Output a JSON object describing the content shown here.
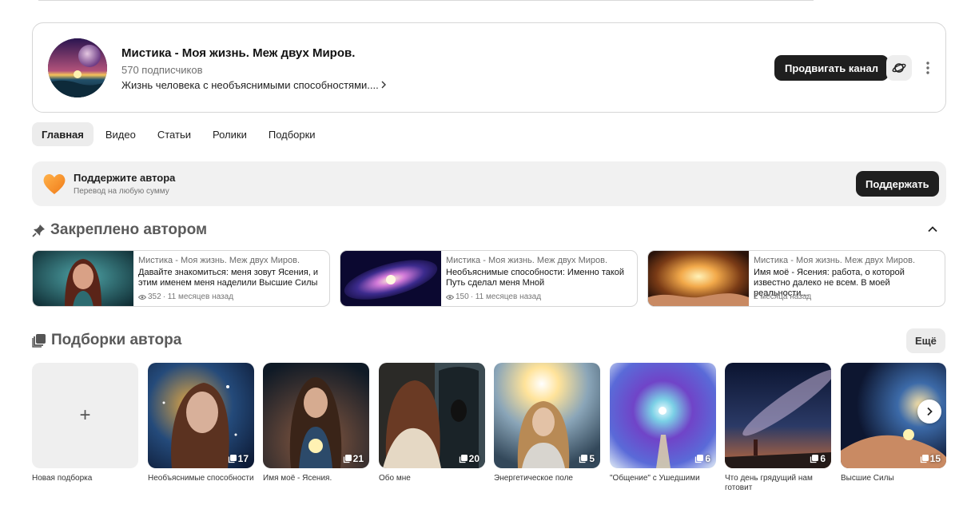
{
  "channel": {
    "title": "Мистика - Моя жизнь. Меж двух Миров.",
    "subscribers": "570 подписчиков",
    "description": "Жизнь человека с необъяснимыми способностями....",
    "promote_label": "Продвигать канал"
  },
  "tabs": [
    {
      "label": "Главная",
      "active": true
    },
    {
      "label": "Видео"
    },
    {
      "label": "Статьи"
    },
    {
      "label": "Ролики"
    },
    {
      "label": "Подборки"
    }
  ],
  "support": {
    "title": "Поддержите автора",
    "subtitle": "Перевод на любую сумму",
    "button_label": "Поддержать"
  },
  "pinned": {
    "heading": "Закреплено автором",
    "cards": [
      {
        "channel": "Мистика - Моя жизнь. Меж двух Миров.",
        "title": "Давайте знакомиться: меня зовут Ясения, и этим именем меня наделили Высшие Силы",
        "views": "352",
        "time": "· 11 месяцев назад"
      },
      {
        "channel": "Мистика - Моя жизнь. Меж двух Миров.",
        "title": "Необъяснимые способности: Именно такой Путь сделал меня Мной",
        "views": "150",
        "time": "· 11 месяцев назад"
      },
      {
        "channel": "Мистика - Моя жизнь. Меж двух Миров.",
        "title": "Имя моё - Ясения: работа, о которой известно далеко не всем. В моей реальности...",
        "views": "",
        "time": "2 месяца назад"
      }
    ]
  },
  "collections": {
    "heading": "Подборки автора",
    "more_label": "Ещё",
    "new_label": "Новая подборка",
    "new_symbol": "+",
    "items": [
      {
        "label": "Необъяснимые способности",
        "count": "17"
      },
      {
        "label": "Имя моё - Ясения.",
        "count": "21"
      },
      {
        "label": "Обо мне",
        "count": "20"
      },
      {
        "label": "Энергетическое поле",
        "count": "5"
      },
      {
        "label": "\"Общение\" с Ушедшими",
        "count": "6"
      },
      {
        "label": "Что день грядущий нам готовит",
        "count": "6"
      },
      {
        "label": "Высшие Силы",
        "count": "15"
      }
    ]
  },
  "colors": {
    "dark_button": "#1f1f1f",
    "heart": "#f59a2c",
    "muted_text": "#6f6f6f"
  }
}
